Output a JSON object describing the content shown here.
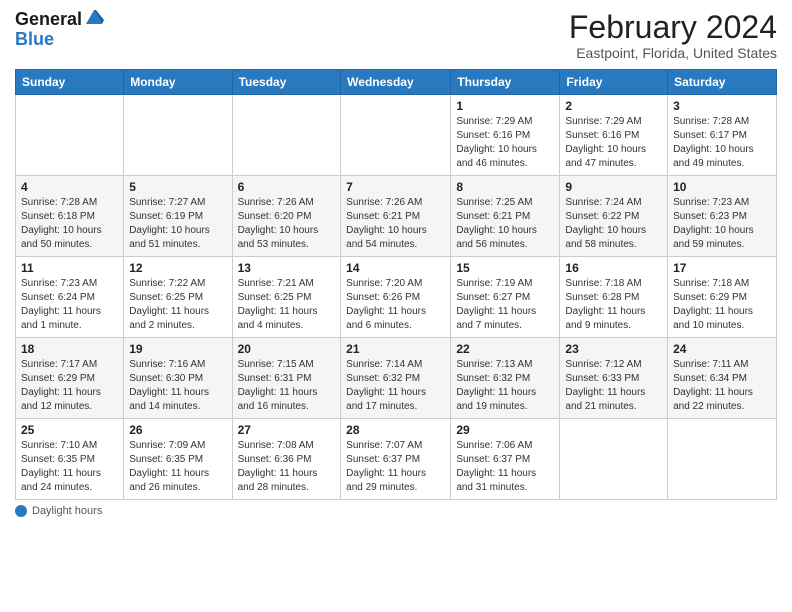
{
  "header": {
    "logo_line1": "General",
    "logo_line2": "Blue",
    "title": "February 2024",
    "subtitle": "Eastpoint, Florida, United States"
  },
  "days_of_week": [
    "Sunday",
    "Monday",
    "Tuesday",
    "Wednesday",
    "Thursday",
    "Friday",
    "Saturday"
  ],
  "weeks": [
    [
      {
        "day": "",
        "info": ""
      },
      {
        "day": "",
        "info": ""
      },
      {
        "day": "",
        "info": ""
      },
      {
        "day": "",
        "info": ""
      },
      {
        "day": "1",
        "info": "Sunrise: 7:29 AM\nSunset: 6:16 PM\nDaylight: 10 hours\nand 46 minutes."
      },
      {
        "day": "2",
        "info": "Sunrise: 7:29 AM\nSunset: 6:16 PM\nDaylight: 10 hours\nand 47 minutes."
      },
      {
        "day": "3",
        "info": "Sunrise: 7:28 AM\nSunset: 6:17 PM\nDaylight: 10 hours\nand 49 minutes."
      }
    ],
    [
      {
        "day": "4",
        "info": "Sunrise: 7:28 AM\nSunset: 6:18 PM\nDaylight: 10 hours\nand 50 minutes."
      },
      {
        "day": "5",
        "info": "Sunrise: 7:27 AM\nSunset: 6:19 PM\nDaylight: 10 hours\nand 51 minutes."
      },
      {
        "day": "6",
        "info": "Sunrise: 7:26 AM\nSunset: 6:20 PM\nDaylight: 10 hours\nand 53 minutes."
      },
      {
        "day": "7",
        "info": "Sunrise: 7:26 AM\nSunset: 6:21 PM\nDaylight: 10 hours\nand 54 minutes."
      },
      {
        "day": "8",
        "info": "Sunrise: 7:25 AM\nSunset: 6:21 PM\nDaylight: 10 hours\nand 56 minutes."
      },
      {
        "day": "9",
        "info": "Sunrise: 7:24 AM\nSunset: 6:22 PM\nDaylight: 10 hours\nand 58 minutes."
      },
      {
        "day": "10",
        "info": "Sunrise: 7:23 AM\nSunset: 6:23 PM\nDaylight: 10 hours\nand 59 minutes."
      }
    ],
    [
      {
        "day": "11",
        "info": "Sunrise: 7:23 AM\nSunset: 6:24 PM\nDaylight: 11 hours\nand 1 minute."
      },
      {
        "day": "12",
        "info": "Sunrise: 7:22 AM\nSunset: 6:25 PM\nDaylight: 11 hours\nand 2 minutes."
      },
      {
        "day": "13",
        "info": "Sunrise: 7:21 AM\nSunset: 6:25 PM\nDaylight: 11 hours\nand 4 minutes."
      },
      {
        "day": "14",
        "info": "Sunrise: 7:20 AM\nSunset: 6:26 PM\nDaylight: 11 hours\nand 6 minutes."
      },
      {
        "day": "15",
        "info": "Sunrise: 7:19 AM\nSunset: 6:27 PM\nDaylight: 11 hours\nand 7 minutes."
      },
      {
        "day": "16",
        "info": "Sunrise: 7:18 AM\nSunset: 6:28 PM\nDaylight: 11 hours\nand 9 minutes."
      },
      {
        "day": "17",
        "info": "Sunrise: 7:18 AM\nSunset: 6:29 PM\nDaylight: 11 hours\nand 10 minutes."
      }
    ],
    [
      {
        "day": "18",
        "info": "Sunrise: 7:17 AM\nSunset: 6:29 PM\nDaylight: 11 hours\nand 12 minutes."
      },
      {
        "day": "19",
        "info": "Sunrise: 7:16 AM\nSunset: 6:30 PM\nDaylight: 11 hours\nand 14 minutes."
      },
      {
        "day": "20",
        "info": "Sunrise: 7:15 AM\nSunset: 6:31 PM\nDaylight: 11 hours\nand 16 minutes."
      },
      {
        "day": "21",
        "info": "Sunrise: 7:14 AM\nSunset: 6:32 PM\nDaylight: 11 hours\nand 17 minutes."
      },
      {
        "day": "22",
        "info": "Sunrise: 7:13 AM\nSunset: 6:32 PM\nDaylight: 11 hours\nand 19 minutes."
      },
      {
        "day": "23",
        "info": "Sunrise: 7:12 AM\nSunset: 6:33 PM\nDaylight: 11 hours\nand 21 minutes."
      },
      {
        "day": "24",
        "info": "Sunrise: 7:11 AM\nSunset: 6:34 PM\nDaylight: 11 hours\nand 22 minutes."
      }
    ],
    [
      {
        "day": "25",
        "info": "Sunrise: 7:10 AM\nSunset: 6:35 PM\nDaylight: 11 hours\nand 24 minutes."
      },
      {
        "day": "26",
        "info": "Sunrise: 7:09 AM\nSunset: 6:35 PM\nDaylight: 11 hours\nand 26 minutes."
      },
      {
        "day": "27",
        "info": "Sunrise: 7:08 AM\nSunset: 6:36 PM\nDaylight: 11 hours\nand 28 minutes."
      },
      {
        "day": "28",
        "info": "Sunrise: 7:07 AM\nSunset: 6:37 PM\nDaylight: 11 hours\nand 29 minutes."
      },
      {
        "day": "29",
        "info": "Sunrise: 7:06 AM\nSunset: 6:37 PM\nDaylight: 11 hours\nand 31 minutes."
      },
      {
        "day": "",
        "info": ""
      },
      {
        "day": "",
        "info": ""
      }
    ]
  ],
  "footer": {
    "label": "Daylight hours"
  }
}
